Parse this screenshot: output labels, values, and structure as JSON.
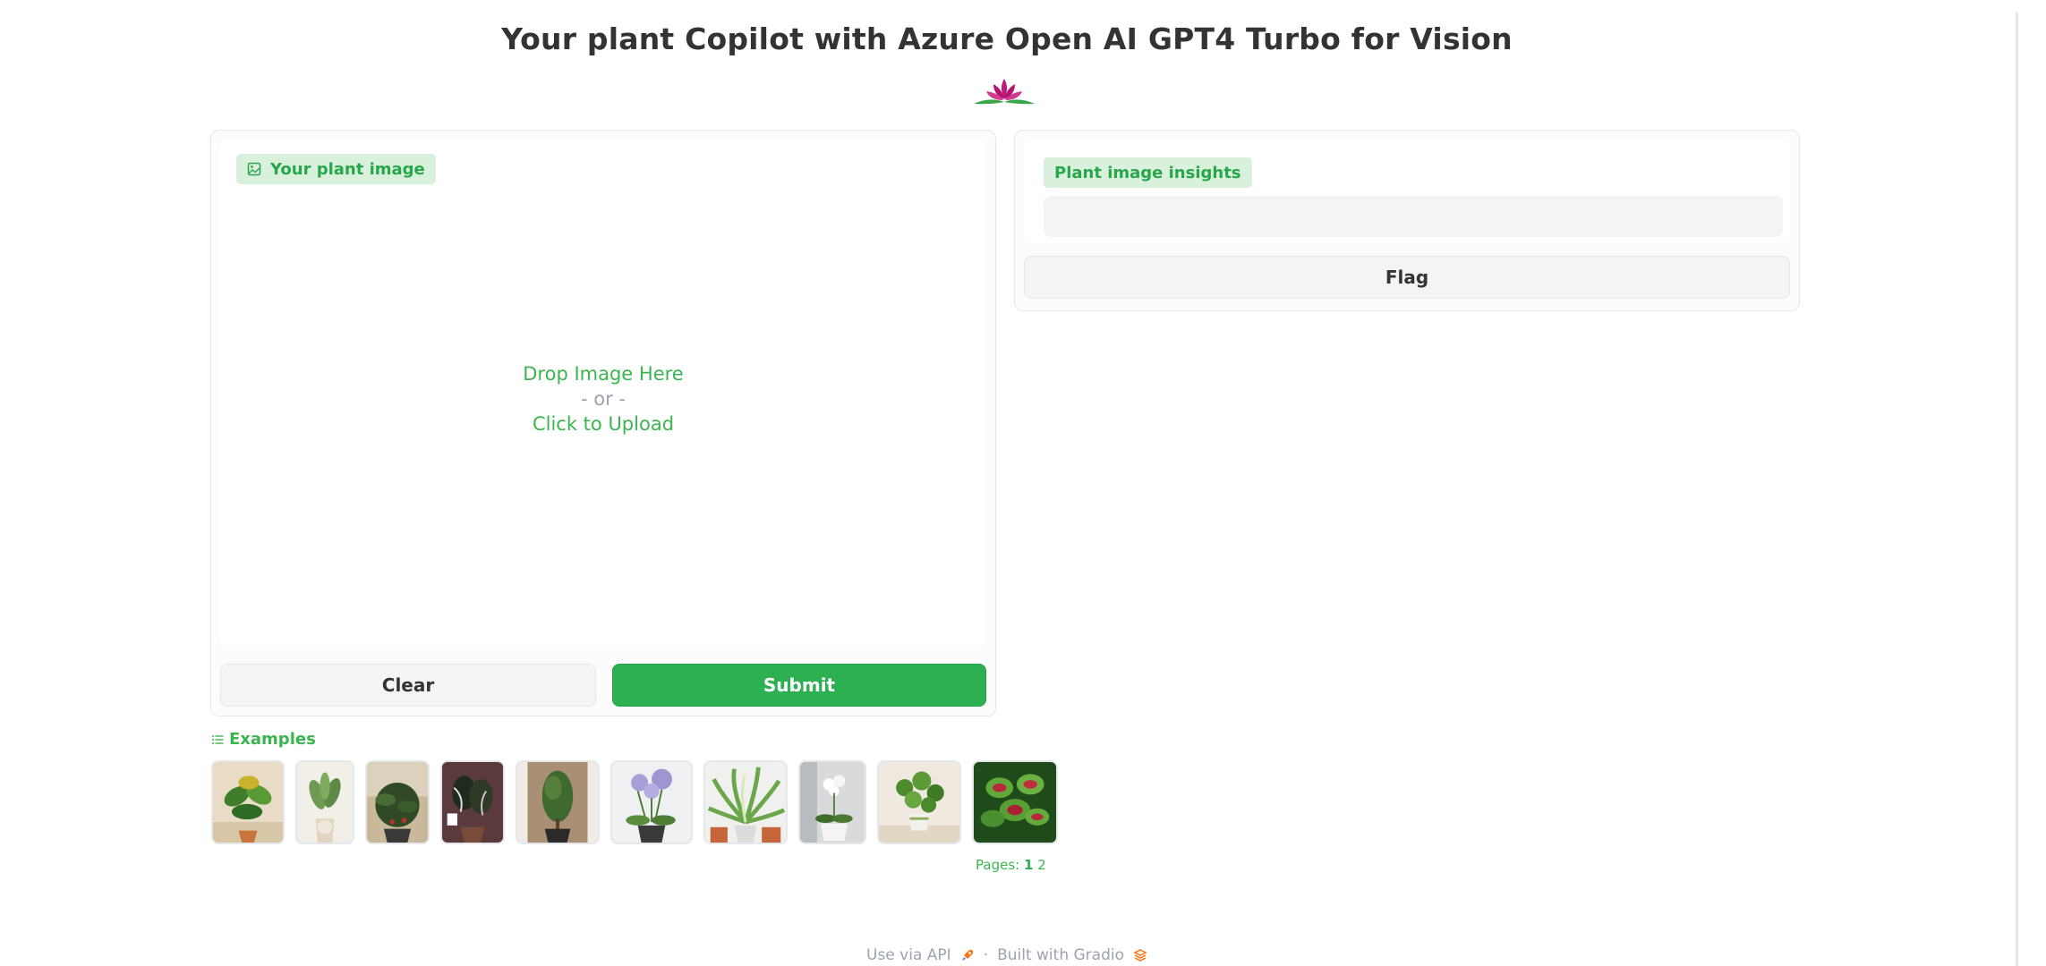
{
  "page": {
    "title": "Your plant Copilot with Azure Open AI GPT4 Turbo for Vision"
  },
  "input_panel": {
    "label": "Your plant image",
    "drop_text": "Drop Image Here",
    "or_text": "- or -",
    "upload_text": "Click to Upload",
    "clear_label": "Clear",
    "submit_label": "Submit"
  },
  "output_panel": {
    "label": "Plant image insights",
    "value": "",
    "flag_label": "Flag"
  },
  "examples": {
    "label": "Examples",
    "items": [
      {
        "name": "example-plant-1"
      },
      {
        "name": "example-plant-2"
      },
      {
        "name": "example-plant-3"
      },
      {
        "name": "example-plant-4"
      },
      {
        "name": "example-plant-5"
      },
      {
        "name": "example-plant-6"
      },
      {
        "name": "example-plant-7"
      },
      {
        "name": "example-plant-8"
      },
      {
        "name": "example-plant-9"
      },
      {
        "name": "example-plant-10"
      }
    ],
    "pages_label": "Pages:",
    "pages": [
      "1",
      "2"
    ],
    "current_page": "1"
  },
  "footer": {
    "api_label": "Use via API",
    "separator": "·",
    "built_label": "Built with Gradio"
  },
  "colors": {
    "accent": "#2cb052",
    "accent_light": "#d9f1dc",
    "text": "#333333",
    "muted": "#9ca3af"
  },
  "icons": {
    "logo": "lotus-icon",
    "image_label": "image-icon",
    "examples_label": "list-icon",
    "api": "rocket-icon",
    "gradio": "gradio-logo-icon"
  }
}
